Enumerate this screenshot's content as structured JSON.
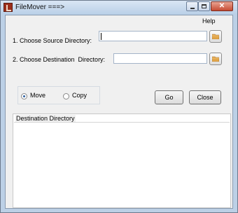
{
  "window": {
    "title": "FileMover ===>"
  },
  "menu": {
    "help": "Help"
  },
  "form": {
    "source_label": "1. Choose Source Directory:",
    "source_value": "",
    "destination_label": "2. Choose Destination  Directory:",
    "destination_value": ""
  },
  "mode": {
    "options": [
      {
        "label": "Move",
        "selected": true
      },
      {
        "label": "Copy",
        "selected": false
      }
    ]
  },
  "buttons": {
    "go": "Go",
    "close": "Close"
  },
  "destination_panel": {
    "title": "Destination Directory"
  },
  "icons": {
    "browse_source": "folder-icon",
    "browse_destination": "folder-icon"
  },
  "colors": {
    "title_bar": "#c8daee",
    "close_button": "#c64b33",
    "client_bg": "#f0f0f0"
  }
}
